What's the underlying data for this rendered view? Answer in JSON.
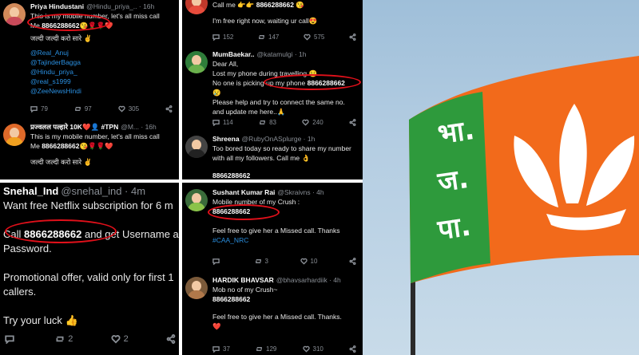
{
  "panel1": {
    "t1": {
      "name": "Priya Hindustani",
      "handle": "@Hindu_priya_.. · 16h",
      "l1": "This is my mobile number, let's all miss call",
      "me": "Me",
      "num": "8866288662",
      "emoji": "😘🌹🌹❤️",
      "hindi": "जल्दी जल्दी करो सारे ✌️",
      "mentions": [
        "@Real_Anuj",
        "@TajinderBagga",
        "@Hindu_priya_",
        "@real_s1999",
        "@ZeeNewsHindi"
      ],
      "replies": "79",
      "retweets": "97",
      "likes": "305"
    },
    "t2": {
      "name": "प्रज्वलल पल्हारे 10K❤️👤 #TPN",
      "handle": "@M... · 16h",
      "l1": "This is my mobile number, let's all miss call",
      "me": "Me",
      "num": "8866288662",
      "emoji": "😘🌹🌹❤️",
      "hindi": "जल्दी जल्दी करो सारे ✌️"
    }
  },
  "panel2": {
    "t1": {
      "l1": "Call me 👉👉",
      "num": "8866288662",
      "emoji": "😘",
      "l2": "I'm free right now, waiting ur call😍",
      "replies": "152",
      "retweets": "147",
      "likes": "575"
    },
    "t2": {
      "name": "MumBaekar..",
      "handle": "@katamulgi · 1h",
      "l1": "Dear All,",
      "l2": "Lost my phone during travelling 😢",
      "l3a": "No one is picking up my phone",
      "num": "8866288662",
      "l4": "😢",
      "l5": "Please help and try to connect the same no.",
      "l6": "and update me here..🙏",
      "replies": "114",
      "retweets": "83",
      "likes": "240"
    },
    "t3": {
      "name": "Shreena",
      "handle": "@RubyOnASplurge · 1h",
      "l1": "Too bored today so ready to share my number",
      "l2": "with all my followers. Call me 👌",
      "num": "8866288662"
    }
  },
  "panel3": {
    "name": "Snehal_Ind",
    "handle": "@snehal_ind · 4m",
    "l1": "Want free Netflix subscription for 6 m",
    "l2a": "Call",
    "num": "8866288662",
    "l2b": "and get Username a",
    "l3": "Password.",
    "l4": "Promotional offer, valid only for first 1",
    "l5": "callers.",
    "l6": "Try your luck 👍",
    "replies": "",
    "retweets": "2",
    "likes": "2"
  },
  "panel4": {
    "t1": {
      "name": "Sushant Kumar Rai",
      "handle": "@Skraivns · 4h",
      "l1": "Mobile number of my Crush :",
      "num": "8866288662",
      "l2": "Feel free to give her a Missed call. Thanks",
      "tag": "#CAA_NRC",
      "replies": "",
      "retweets": "3",
      "likes": "10"
    },
    "t2": {
      "name": "HARDIK BHAVSAR",
      "handle": "@bhavsarhardiik · 4h",
      "l1": "Mob no of my Crush~",
      "num": "8866288662",
      "l2": "Feel free to give her a Missed call. Thanks.",
      "l3": "❤️",
      "replies": "37",
      "retweets": "129",
      "likes": "310"
    }
  },
  "flag": {
    "script": "भा.ज.पा.",
    "colors": {
      "saffron": "#f26a1b",
      "green": "#2e9a3c",
      "white": "#ffffff"
    }
  }
}
